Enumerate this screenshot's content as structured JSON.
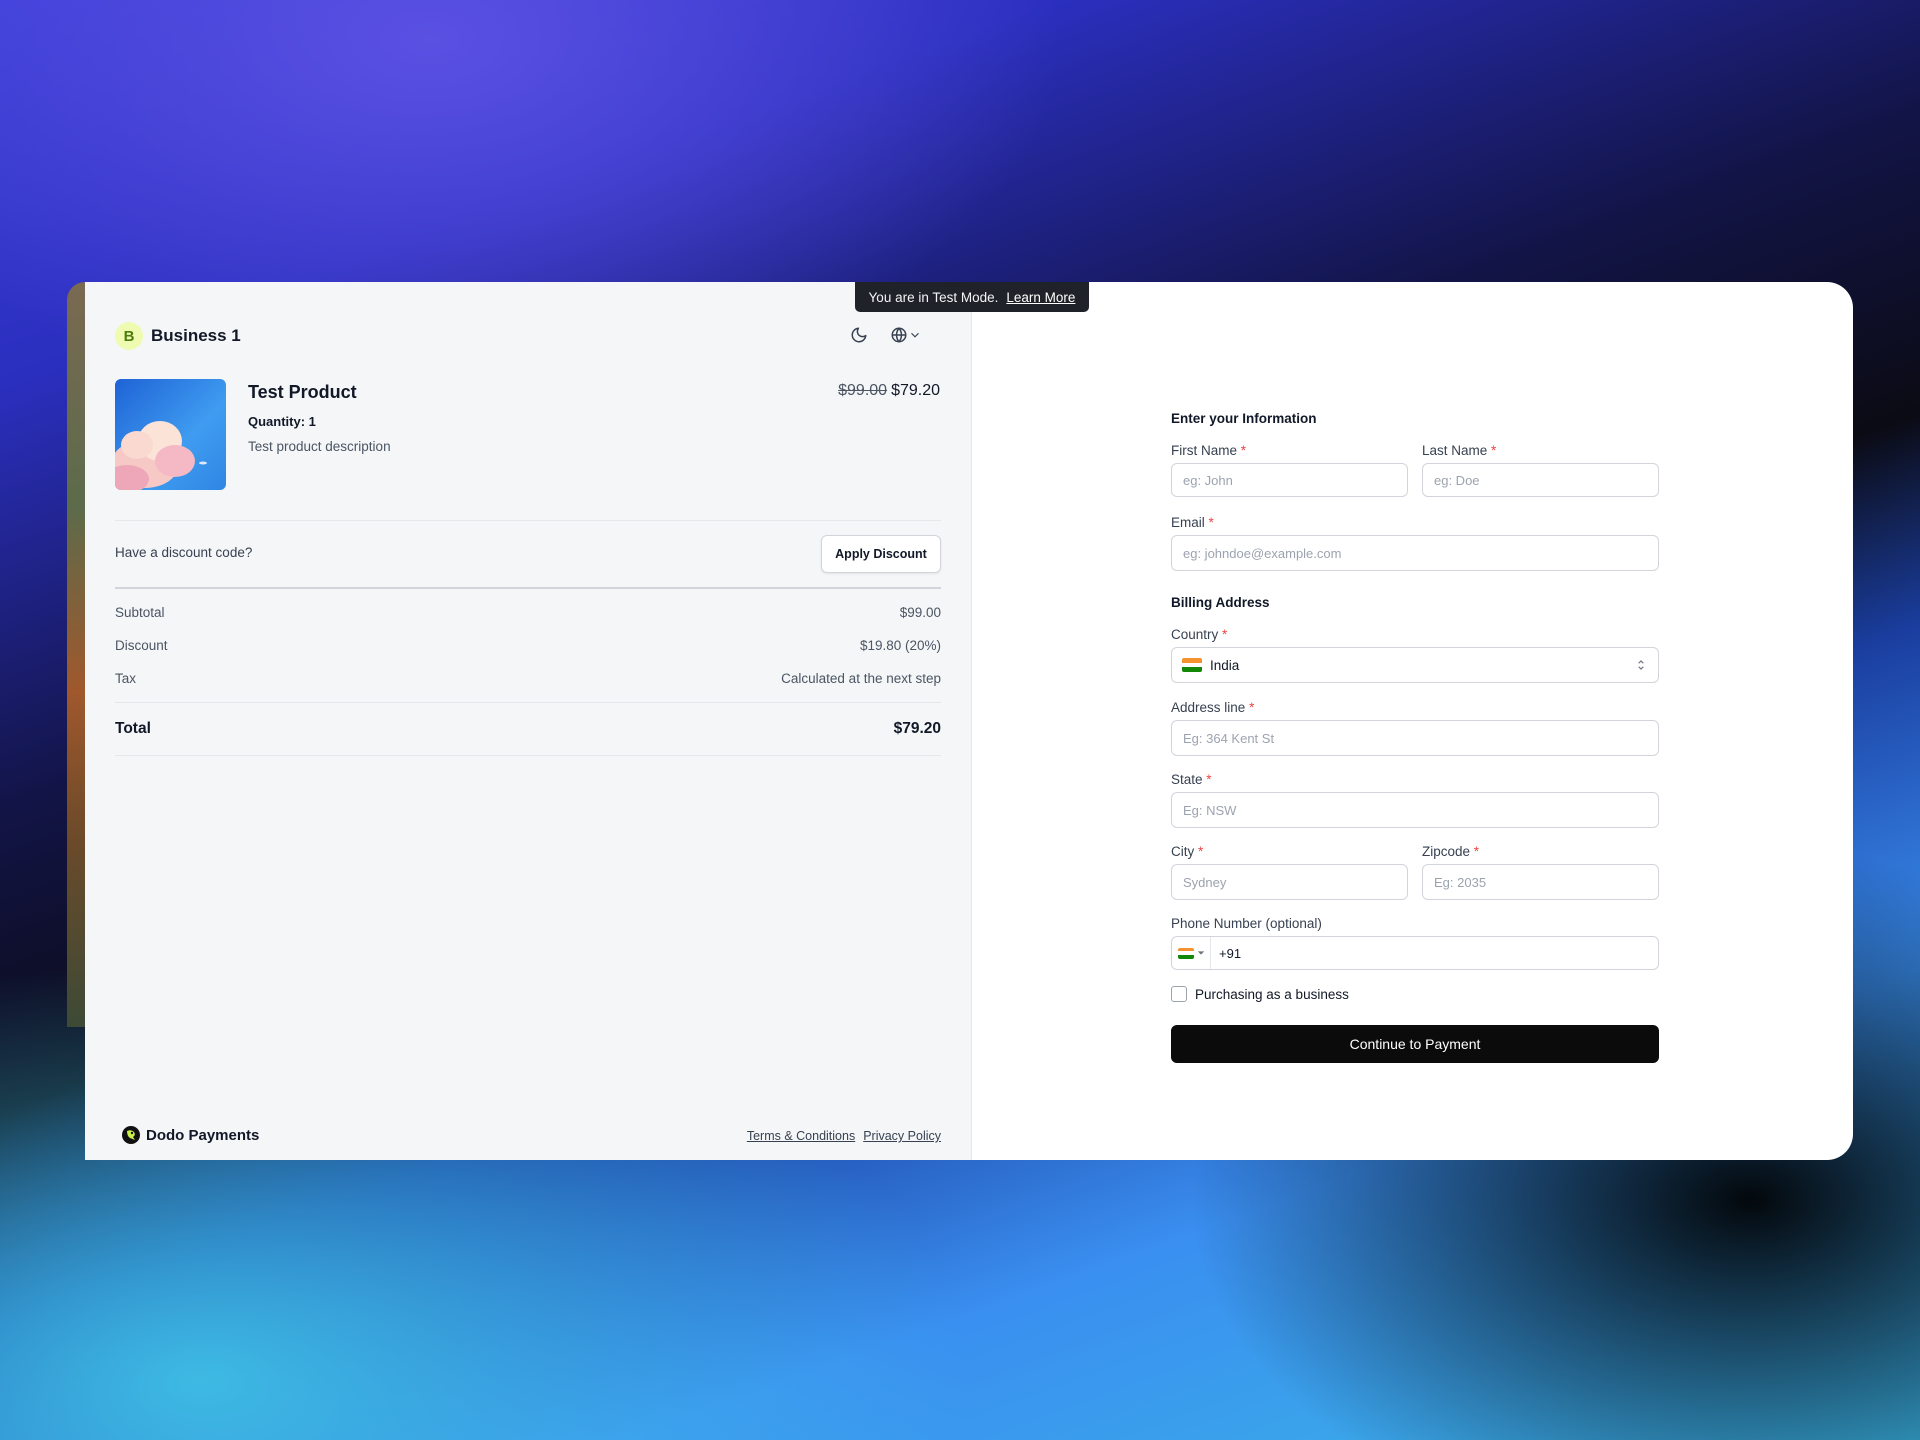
{
  "test_mode": {
    "text": "You are in Test Mode.",
    "link": "Learn More"
  },
  "business": {
    "initial": "B",
    "name": "Business 1"
  },
  "icons": {
    "theme": "moon-icon",
    "language": "globe-icon",
    "chevron": "chevron-down-icon"
  },
  "product": {
    "title": "Test Product",
    "quantity": "Quantity: 1",
    "description": "Test product description",
    "original_price": "$99.00",
    "price": "$79.20"
  },
  "discount": {
    "question": "Have a discount code?",
    "button": "Apply Discount"
  },
  "summary": {
    "subtotal_label": "Subtotal",
    "subtotal_value": "$99.00",
    "discount_label": "Discount",
    "discount_value": "$19.80 (20%)",
    "tax_label": "Tax",
    "tax_value": "Calculated at the next step",
    "total_label": "Total",
    "total_value": "$79.20"
  },
  "footer": {
    "brand": "Dodo Payments",
    "terms": "Terms & Conditions",
    "privacy": "Privacy Policy"
  },
  "form": {
    "info_title": "Enter your Information",
    "first_name": {
      "label": "First Name",
      "placeholder": "eg: John"
    },
    "last_name": {
      "label": "Last Name",
      "placeholder": "eg: Doe"
    },
    "email": {
      "label": "Email",
      "placeholder": "eg: johndoe@example.com"
    },
    "billing_title": "Billing Address",
    "country": {
      "label": "Country",
      "value": "India"
    },
    "address": {
      "label": "Address line",
      "placeholder": "Eg: 364 Kent St"
    },
    "state": {
      "label": "State",
      "placeholder": "Eg: NSW"
    },
    "city": {
      "label": "City",
      "placeholder": "Sydney"
    },
    "zipcode": {
      "label": "Zipcode",
      "placeholder": "Eg: 2035"
    },
    "phone": {
      "label": "Phone Number (optional)",
      "value": "+91"
    },
    "business_checkbox": "Purchasing as a business",
    "submit": "Continue to Payment",
    "required_mark": "*"
  },
  "colors": {
    "accent": "#0b0b0b",
    "required": "#ef4444",
    "badge_bg": "#eefbb0",
    "badge_text": "#4d7c0f"
  }
}
